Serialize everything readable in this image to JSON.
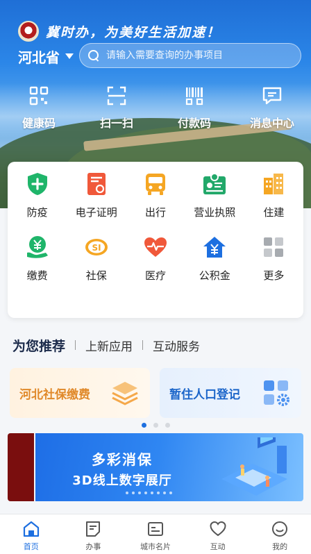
{
  "header": {
    "slogan": "冀时办，为美好生活加速！",
    "region": "河北省",
    "search_placeholder": "请输入需要查询的办事项目"
  },
  "quick_actions": [
    {
      "label": "健康码",
      "icon": "health-code-icon"
    },
    {
      "label": "扫一扫",
      "icon": "scan-icon"
    },
    {
      "label": "付款码",
      "icon": "payment-code-icon"
    },
    {
      "label": "消息中心",
      "icon": "message-icon"
    }
  ],
  "services": [
    {
      "label": "防疫",
      "icon": "epidemic-shield-icon",
      "color": "#1fb56a"
    },
    {
      "label": "电子证明",
      "icon": "certificate-icon",
      "color": "#f0583a"
    },
    {
      "label": "出行",
      "icon": "bus-icon",
      "color": "#f5a623"
    },
    {
      "label": "营业执照",
      "icon": "license-icon",
      "color": "#22a86a"
    },
    {
      "label": "住建",
      "icon": "building-icon",
      "color": "#f5a623"
    },
    {
      "label": "缴费",
      "icon": "payment-icon",
      "color": "#1fb56a"
    },
    {
      "label": "社保",
      "icon": "social-security-icon",
      "color": "#f5a623"
    },
    {
      "label": "医疗",
      "icon": "heart-icon",
      "color": "#f0583a"
    },
    {
      "label": "公积金",
      "icon": "housing-fund-icon",
      "color": "#1d6fe0"
    },
    {
      "label": "更多",
      "icon": "more-grid-icon",
      "color": "#9aa0a6"
    }
  ],
  "tabs": [
    {
      "label": "为您推荐",
      "active": true
    },
    {
      "label": "上新应用",
      "active": false
    },
    {
      "label": "互动服务",
      "active": false
    }
  ],
  "promos": [
    {
      "label": "河北社保缴费",
      "icon": "stack-layers-icon"
    },
    {
      "label": "暂住人口登记",
      "icon": "apps-gear-icon"
    }
  ],
  "carousel": {
    "pages": 3,
    "current": 1
  },
  "banner": {
    "line1": "多彩消保",
    "line2": "3D线上数字展厅"
  },
  "bottom_nav": [
    {
      "label": "首页",
      "icon": "home-icon",
      "active": true
    },
    {
      "label": "办事",
      "icon": "document-icon",
      "active": false
    },
    {
      "label": "城市名片",
      "icon": "city-card-icon",
      "active": false
    },
    {
      "label": "互动",
      "icon": "heart-outline-icon",
      "active": false
    },
    {
      "label": "我的",
      "icon": "smile-icon",
      "active": false
    }
  ],
  "colors": {
    "brand_blue": "#1d6fe0",
    "promo_orange": "#e0892a"
  }
}
